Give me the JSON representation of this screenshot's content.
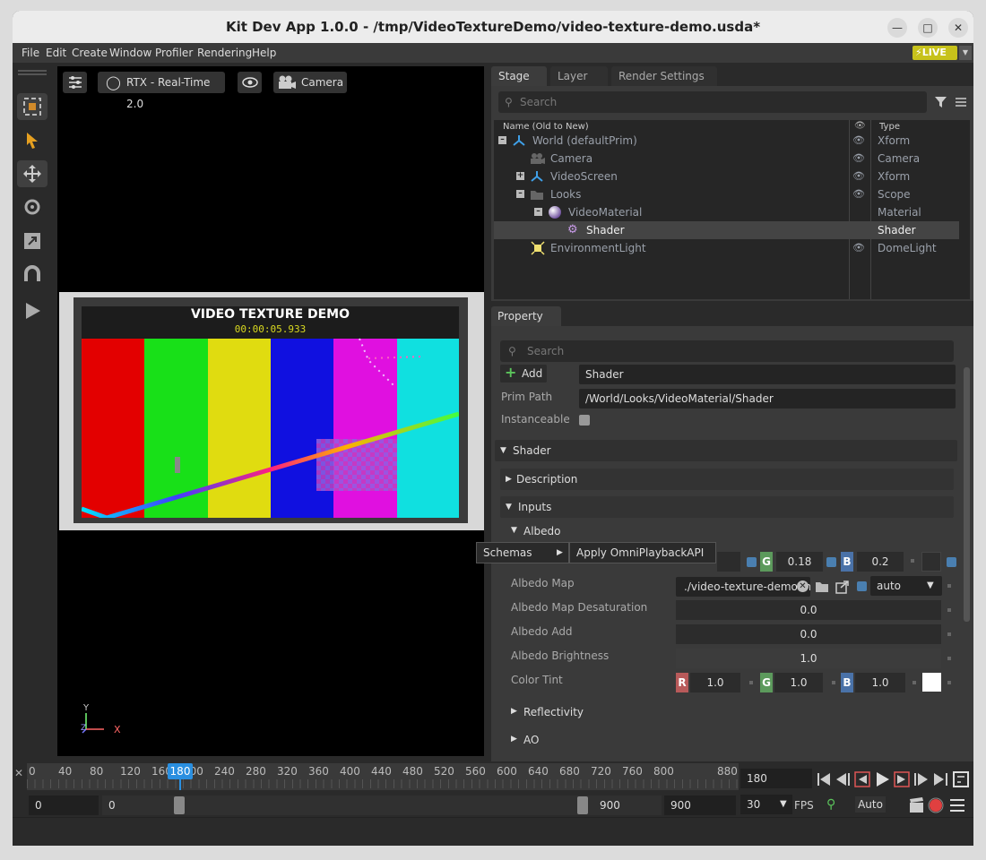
{
  "window": {
    "title": "Kit Dev App 1.0.0 - /tmp/VideoTextureDemo/video-texture-demo.usda*"
  },
  "menu": [
    "File",
    "Edit",
    "Create",
    "Window",
    "Profiler",
    "Rendering",
    "Help"
  ],
  "live": {
    "label": "LIVE"
  },
  "viewport": {
    "renderer": "RTX - Real-Time 2.0",
    "camera": "Camera",
    "video_title": "VIDEO TEXTURE DEMO",
    "video_time": "00:00:05.933",
    "axis_x": "X",
    "axis_y": "Y",
    "axis_z": "Z"
  },
  "stage": {
    "tabs": [
      "Stage",
      "Layer",
      "Render Settings"
    ],
    "search_placeholder": "Search",
    "col_name": "Name (Old to New)",
    "col_type": "Type",
    "rows": [
      {
        "name": "World (defaultPrim)",
        "type": "Xform"
      },
      {
        "name": "Camera",
        "type": "Camera"
      },
      {
        "name": "VideoScreen",
        "type": "Xform"
      },
      {
        "name": "Looks",
        "type": "Scope"
      },
      {
        "name": "VideoMaterial",
        "type": "Material"
      },
      {
        "name": "Shader",
        "type": "Shader"
      },
      {
        "name": "EnvironmentLight",
        "type": "DomeLight"
      }
    ]
  },
  "property": {
    "tab": "Property",
    "search_placeholder": "Search",
    "add_label": "Add",
    "prim_name": "Shader",
    "prim_path_label": "Prim Path",
    "prim_path": "/World/Looks/VideoMaterial/Shader",
    "instanceable_label": "Instanceable",
    "sections": {
      "shader": "Shader",
      "description": "Description",
      "inputs": "Inputs",
      "albedo": "Albedo",
      "reflectivity": "Reflectivity",
      "ao": "AO"
    },
    "albedo_color": {
      "g_label": "G",
      "g": "0.18",
      "b_label": "B",
      "b": "0.2"
    },
    "albedo_map_label": "Albedo Map",
    "albedo_map_value": "./video-texture-demo.m",
    "albedo_map_mode": "auto",
    "albedo_map_desat_label": "Albedo Map Desaturation",
    "albedo_map_desat": "0.0",
    "albedo_add_label": "Albedo Add",
    "albedo_add": "0.0",
    "albedo_brightness_label": "Albedo Brightness",
    "albedo_brightness": "1.0",
    "color_tint_label": "Color Tint",
    "color_tint": {
      "r_label": "R",
      "r": "1.0",
      "g_label": "G",
      "g": "1.0",
      "b_label": "B",
      "b": "1.0"
    }
  },
  "context_menu": {
    "schemas": "Schemas",
    "apply": "Apply OmniPlaybackAPI"
  },
  "timeline": {
    "ticks": [
      "0",
      "40",
      "80",
      "120",
      "160",
      "200",
      "240",
      "280",
      "320",
      "360",
      "400",
      "440",
      "480",
      "520",
      "560",
      "600",
      "640",
      "680",
      "720",
      "760",
      "800",
      "880"
    ],
    "current_tick": "180",
    "current_frame": "180",
    "start": "0",
    "range_start": "0",
    "range_end": "900",
    "end": "900",
    "fps_value": "30",
    "fps_label": "FPS",
    "auto_label": "Auto"
  }
}
